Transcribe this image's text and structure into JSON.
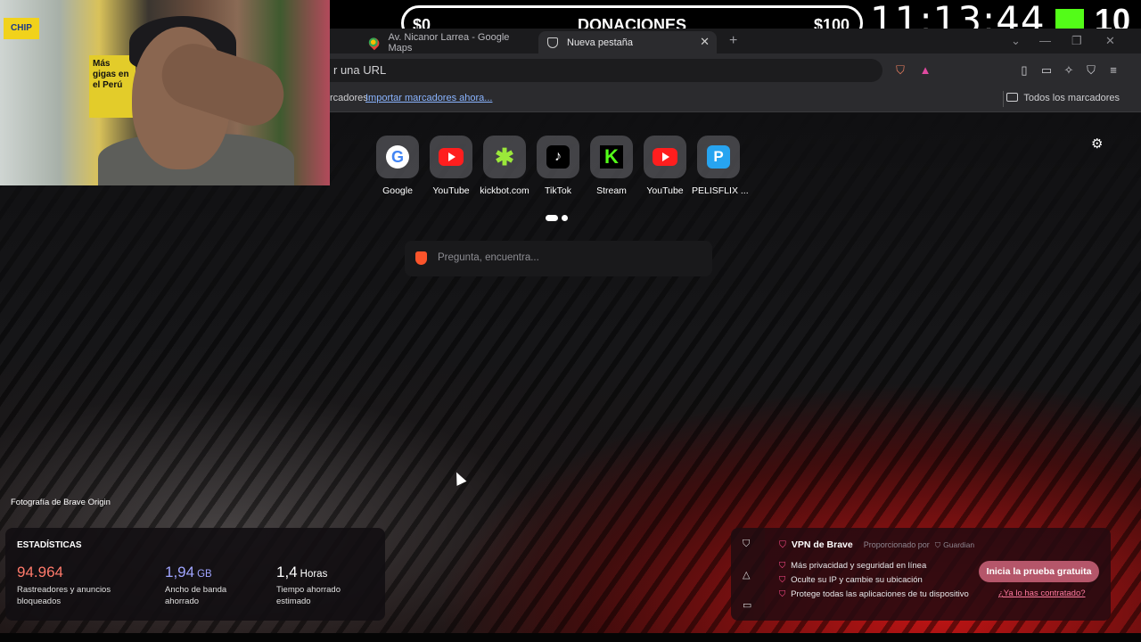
{
  "stream_overlay": {
    "donation_min": "$0",
    "donation_title": "DONACIONES",
    "donation_max": "$100",
    "clock": "11:13:44",
    "viewer_count": "10"
  },
  "tabs": [
    {
      "title": "Av. Nicanor Larrea - Google Maps",
      "active": false,
      "icon": "google-maps-pin-icon"
    },
    {
      "title": "Nueva pestaña",
      "active": true,
      "icon": "brave-shield-icon"
    }
  ],
  "toolbar": {
    "url_text": "r una URL"
  },
  "bookmarks": {
    "prefix": "rcadores",
    "import_link": "Importar marcadores ahora...",
    "all_bookmarks": "Todos los marcadores"
  },
  "top_sites": [
    {
      "label": "Google",
      "icon": "google-icon"
    },
    {
      "label": "YouTube",
      "icon": "youtube-icon"
    },
    {
      "label": "kickbot.com",
      "icon": "kickbot-icon"
    },
    {
      "label": "TikTok",
      "icon": "tiktok-icon"
    },
    {
      "label": "Stream",
      "icon": "kick-icon"
    },
    {
      "label": "YouTube",
      "icon": "youtube-icon"
    },
    {
      "label": "PELISFLIX ...",
      "icon": "pelisflix-icon"
    }
  ],
  "search": {
    "placeholder": "Pregunta, encuentra..."
  },
  "photo_credit": "Fotografía de Brave Origin",
  "stats": {
    "title": "ESTADÍSTICAS",
    "trackers": {
      "value": "94.964",
      "unit": "",
      "desc_line1": "Rastreadores y anuncios",
      "desc_line2": "bloqueados"
    },
    "bandwidth": {
      "value": "1,94",
      "unit": "GB",
      "desc_line1": "Ancho de banda",
      "desc_line2": "ahorrado"
    },
    "time": {
      "value": "1,4",
      "unit": "Horas",
      "desc_line1": "Tiempo ahorrado",
      "desc_line2": "estimado"
    }
  },
  "vpn": {
    "title": "VPN de Brave",
    "provided_by": "Proporcionado por",
    "provider": "Guardian",
    "features": [
      "Más privacidad y seguridad en línea",
      "Oculte su IP y cambie su ubicación",
      "Protege todas las aplicaciones de tu dispositivo"
    ],
    "cta": "Inicia la prueba gratuita",
    "already": "¿Ya lo has contratado?"
  },
  "webcam": {
    "sign_text": "Más gigas en el Perú",
    "chip_text": "CHIP"
  },
  "colors": {
    "accent_vpn": "#ff4a8a",
    "trackers_stat": "#ff7a6b",
    "bandwidth_stat": "#a0a5ff",
    "kick_green": "#53fc18"
  }
}
